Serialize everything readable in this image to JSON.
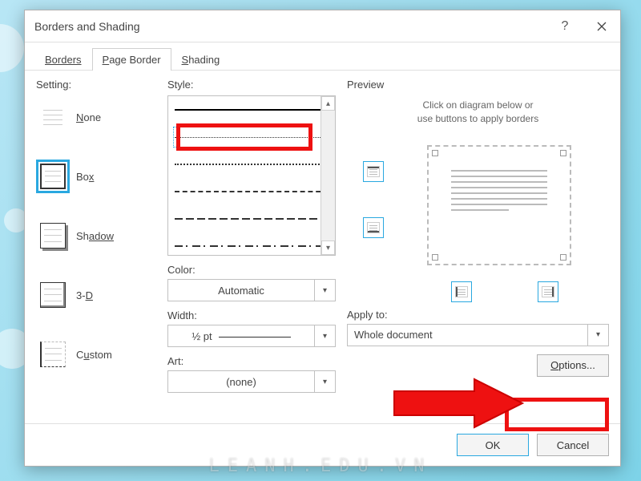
{
  "dialog": {
    "title": "Borders and Shading"
  },
  "tabs": {
    "borders": "Borders",
    "page_border_pre": "P",
    "page_border_post": "age Border",
    "shading_pre": "S",
    "shading_post": "hading"
  },
  "setting": {
    "heading": "Setting:",
    "none_pre": "N",
    "none_post": "one",
    "box_label": "Box",
    "box_pre": "Bo",
    "box_post": "x",
    "shadow_pre": "Sh",
    "shadow_post": "adow",
    "threed": "3-D",
    "threed_pre": "3-",
    "threed_post": "D",
    "custom_pre": "C",
    "custom_middle": "u",
    "custom_post": "stom"
  },
  "style": {
    "heading_pre": "St",
    "heading_u": "y",
    "heading_post": "le:"
  },
  "color": {
    "heading_pre": "C",
    "heading_post": "olor:",
    "value": "Automatic"
  },
  "width": {
    "heading_pre": "W",
    "heading_post": "idth:",
    "value": "½ pt"
  },
  "art": {
    "heading_pre": "A",
    "heading_u": "r",
    "heading_post": "t:",
    "value": "(none)"
  },
  "preview": {
    "heading": "Preview",
    "hint1": "Click on diagram below or",
    "hint2": "use buttons to apply borders"
  },
  "applyto": {
    "heading_pre": "App",
    "heading_u": "l",
    "heading_post": "y to:",
    "value": "Whole document"
  },
  "buttons": {
    "options_pre": "O",
    "options_post": "ptions...",
    "ok": "OK",
    "cancel": "Cancel"
  },
  "watermark": "LEANH.EDU.VN"
}
